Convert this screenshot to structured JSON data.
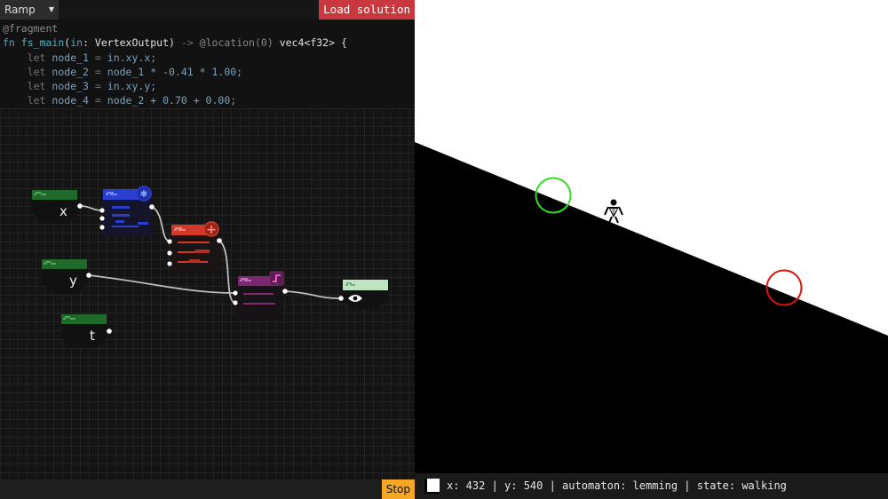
{
  "topbar": {
    "level_select": "Ramp",
    "load_solution": "Load solution"
  },
  "code": {
    "attr": "@fragment",
    "fn_kw": "fn",
    "fn_name": "fs_main",
    "in_kw": "in",
    "in_type": "VertexOutput",
    "arrow": "->",
    "loc": "@location(0)",
    "ret_type": "vec4<f32>",
    "open_brace": "{",
    "lines": [
      {
        "kw": "let",
        "name": "node_1",
        "eq": "=",
        "expr": "in.xy.x;"
      },
      {
        "kw": "let",
        "name": "node_2",
        "eq": "=",
        "expr": "node_1 * -0.41 * 1.00;"
      },
      {
        "kw": "let",
        "name": "node_3",
        "eq": "=",
        "expr": "in.xy.y;"
      },
      {
        "kw": "let",
        "name": "node_4",
        "eq": "=",
        "expr": "node_2 + 0.70 + 0.00;"
      }
    ]
  },
  "graph": {
    "inputs": [
      "x",
      "y",
      "t"
    ]
  },
  "stop_button": "Stop",
  "status": {
    "text": "x: 432 | y: 540 | automaton: lemming | state: walking"
  },
  "colors": {
    "input_node": "#1f6a2a",
    "mult_node": "#2a3fd0",
    "add_node": "#d2392a",
    "step_node": "#7c2870",
    "output_node": "#bfe5c4",
    "start_circle": "#33dd22",
    "goal_circle": "#dd1111",
    "load_button": "#c9383f",
    "stop_button": "#f5a623"
  },
  "icons": {
    "dropdown": "chevron-down-icon",
    "mult_node": "multiply-icon",
    "add_node": "plus-icon",
    "step_node": "step-icon",
    "output_node": "eye-icon",
    "lemming": "lemming-sprite"
  }
}
